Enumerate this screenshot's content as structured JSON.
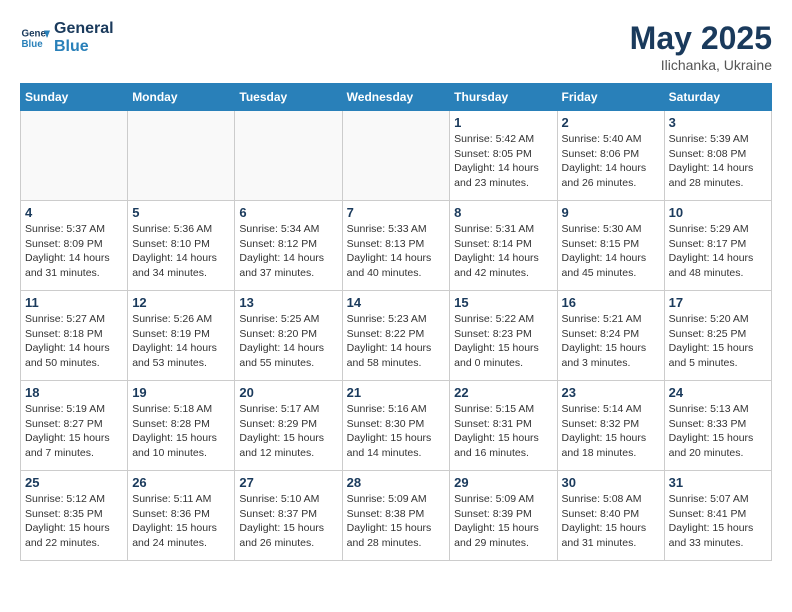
{
  "header": {
    "logo_line1": "General",
    "logo_line2": "Blue",
    "month": "May 2025",
    "location": "Ilichanka, Ukraine"
  },
  "weekdays": [
    "Sunday",
    "Monday",
    "Tuesday",
    "Wednesday",
    "Thursday",
    "Friday",
    "Saturday"
  ],
  "weeks": [
    [
      {
        "day": "",
        "info": ""
      },
      {
        "day": "",
        "info": ""
      },
      {
        "day": "",
        "info": ""
      },
      {
        "day": "",
        "info": ""
      },
      {
        "day": "1",
        "info": "Sunrise: 5:42 AM\nSunset: 8:05 PM\nDaylight: 14 hours\nand 23 minutes."
      },
      {
        "day": "2",
        "info": "Sunrise: 5:40 AM\nSunset: 8:06 PM\nDaylight: 14 hours\nand 26 minutes."
      },
      {
        "day": "3",
        "info": "Sunrise: 5:39 AM\nSunset: 8:08 PM\nDaylight: 14 hours\nand 28 minutes."
      }
    ],
    [
      {
        "day": "4",
        "info": "Sunrise: 5:37 AM\nSunset: 8:09 PM\nDaylight: 14 hours\nand 31 minutes."
      },
      {
        "day": "5",
        "info": "Sunrise: 5:36 AM\nSunset: 8:10 PM\nDaylight: 14 hours\nand 34 minutes."
      },
      {
        "day": "6",
        "info": "Sunrise: 5:34 AM\nSunset: 8:12 PM\nDaylight: 14 hours\nand 37 minutes."
      },
      {
        "day": "7",
        "info": "Sunrise: 5:33 AM\nSunset: 8:13 PM\nDaylight: 14 hours\nand 40 minutes."
      },
      {
        "day": "8",
        "info": "Sunrise: 5:31 AM\nSunset: 8:14 PM\nDaylight: 14 hours\nand 42 minutes."
      },
      {
        "day": "9",
        "info": "Sunrise: 5:30 AM\nSunset: 8:15 PM\nDaylight: 14 hours\nand 45 minutes."
      },
      {
        "day": "10",
        "info": "Sunrise: 5:29 AM\nSunset: 8:17 PM\nDaylight: 14 hours\nand 48 minutes."
      }
    ],
    [
      {
        "day": "11",
        "info": "Sunrise: 5:27 AM\nSunset: 8:18 PM\nDaylight: 14 hours\nand 50 minutes."
      },
      {
        "day": "12",
        "info": "Sunrise: 5:26 AM\nSunset: 8:19 PM\nDaylight: 14 hours\nand 53 minutes."
      },
      {
        "day": "13",
        "info": "Sunrise: 5:25 AM\nSunset: 8:20 PM\nDaylight: 14 hours\nand 55 minutes."
      },
      {
        "day": "14",
        "info": "Sunrise: 5:23 AM\nSunset: 8:22 PM\nDaylight: 14 hours\nand 58 minutes."
      },
      {
        "day": "15",
        "info": "Sunrise: 5:22 AM\nSunset: 8:23 PM\nDaylight: 15 hours\nand 0 minutes."
      },
      {
        "day": "16",
        "info": "Sunrise: 5:21 AM\nSunset: 8:24 PM\nDaylight: 15 hours\nand 3 minutes."
      },
      {
        "day": "17",
        "info": "Sunrise: 5:20 AM\nSunset: 8:25 PM\nDaylight: 15 hours\nand 5 minutes."
      }
    ],
    [
      {
        "day": "18",
        "info": "Sunrise: 5:19 AM\nSunset: 8:27 PM\nDaylight: 15 hours\nand 7 minutes."
      },
      {
        "day": "19",
        "info": "Sunrise: 5:18 AM\nSunset: 8:28 PM\nDaylight: 15 hours\nand 10 minutes."
      },
      {
        "day": "20",
        "info": "Sunrise: 5:17 AM\nSunset: 8:29 PM\nDaylight: 15 hours\nand 12 minutes."
      },
      {
        "day": "21",
        "info": "Sunrise: 5:16 AM\nSunset: 8:30 PM\nDaylight: 15 hours\nand 14 minutes."
      },
      {
        "day": "22",
        "info": "Sunrise: 5:15 AM\nSunset: 8:31 PM\nDaylight: 15 hours\nand 16 minutes."
      },
      {
        "day": "23",
        "info": "Sunrise: 5:14 AM\nSunset: 8:32 PM\nDaylight: 15 hours\nand 18 minutes."
      },
      {
        "day": "24",
        "info": "Sunrise: 5:13 AM\nSunset: 8:33 PM\nDaylight: 15 hours\nand 20 minutes."
      }
    ],
    [
      {
        "day": "25",
        "info": "Sunrise: 5:12 AM\nSunset: 8:35 PM\nDaylight: 15 hours\nand 22 minutes."
      },
      {
        "day": "26",
        "info": "Sunrise: 5:11 AM\nSunset: 8:36 PM\nDaylight: 15 hours\nand 24 minutes."
      },
      {
        "day": "27",
        "info": "Sunrise: 5:10 AM\nSunset: 8:37 PM\nDaylight: 15 hours\nand 26 minutes."
      },
      {
        "day": "28",
        "info": "Sunrise: 5:09 AM\nSunset: 8:38 PM\nDaylight: 15 hours\nand 28 minutes."
      },
      {
        "day": "29",
        "info": "Sunrise: 5:09 AM\nSunset: 8:39 PM\nDaylight: 15 hours\nand 29 minutes."
      },
      {
        "day": "30",
        "info": "Sunrise: 5:08 AM\nSunset: 8:40 PM\nDaylight: 15 hours\nand 31 minutes."
      },
      {
        "day": "31",
        "info": "Sunrise: 5:07 AM\nSunset: 8:41 PM\nDaylight: 15 hours\nand 33 minutes."
      }
    ]
  ]
}
